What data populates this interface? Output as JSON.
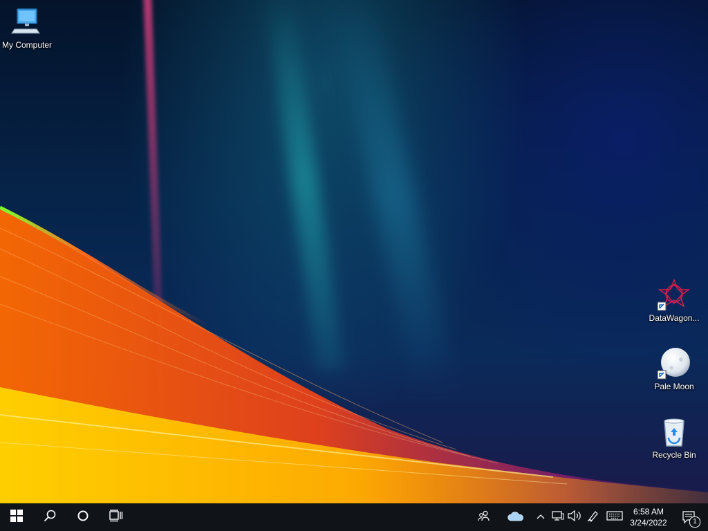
{
  "desktop": {
    "wallpaper": "aurora-wave",
    "icons": [
      {
        "label": "My Computer",
        "icon": "computer-icon"
      },
      {
        "label": "DataWagon...",
        "icon": "datawagon-icon",
        "shortcut": true
      },
      {
        "label": "Pale Moon",
        "icon": "pale-moon-icon",
        "shortcut": true
      },
      {
        "label": "Recycle Bin",
        "icon": "recycle-bin-icon"
      }
    ]
  },
  "taskbar": {
    "start": "windows-logo-icon",
    "search": "search-icon",
    "cortana": "cortana-circle-icon",
    "task_view": "task-view-icon",
    "tray": {
      "people": "people-icon",
      "onedrive": "onedrive-cloud-icon",
      "chevron": "chevron-up-icon",
      "network": "network-icon",
      "volume": "volume-icon",
      "pen": "pen-workspace-icon",
      "keyboard": "touch-keyboard-icon"
    },
    "clock": {
      "time": "6:58 AM",
      "date": "3/24/2022"
    },
    "notifications": {
      "icon": "action-center-icon",
      "count": "1"
    }
  },
  "colors": {
    "taskbar": "#101418",
    "text": "#ffffff"
  }
}
